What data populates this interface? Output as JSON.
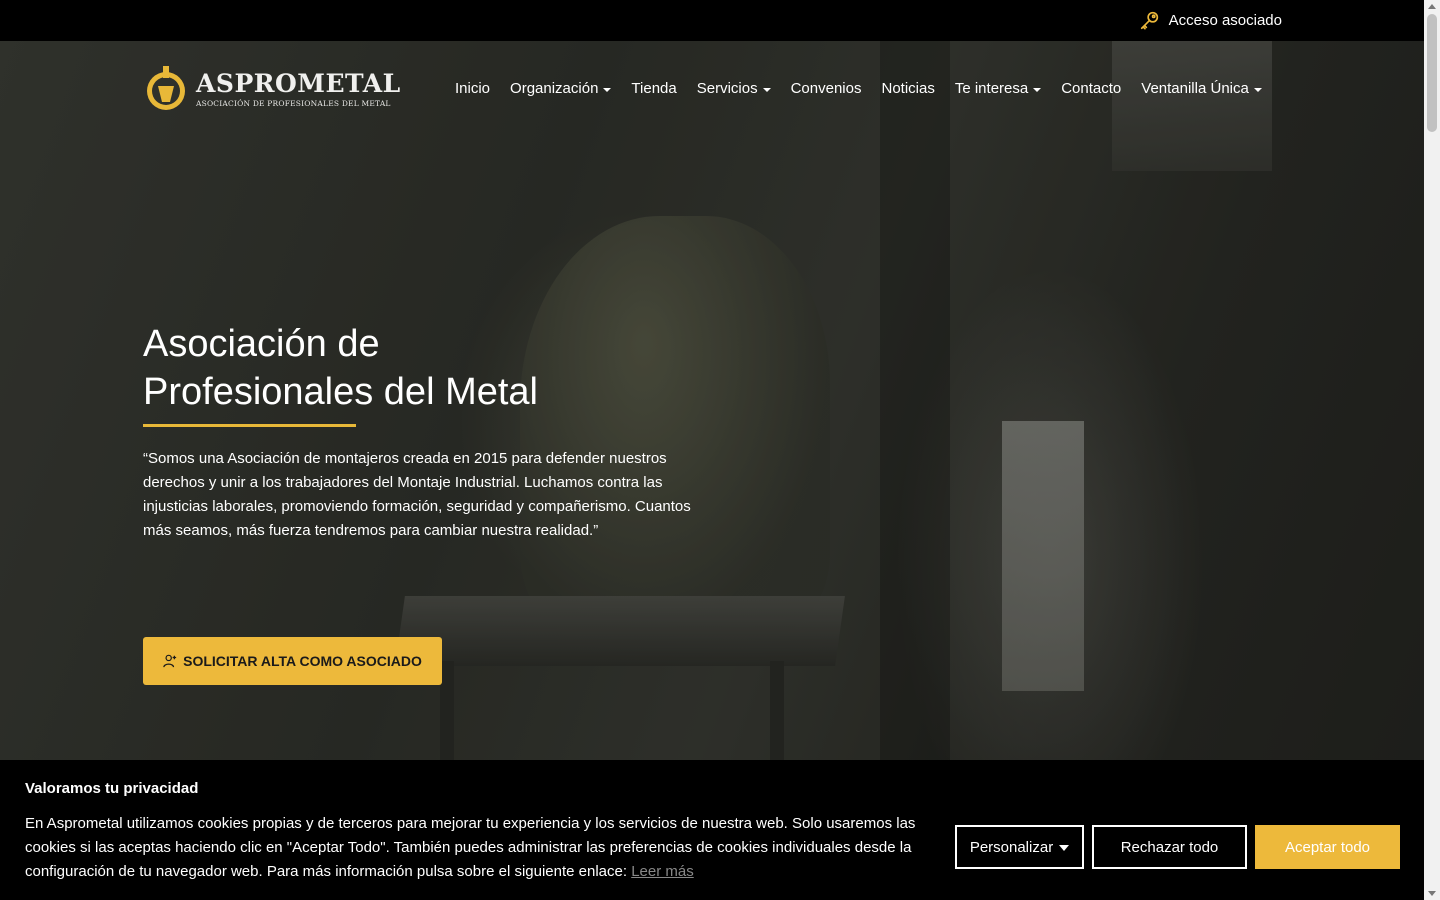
{
  "topbar": {
    "access_label": "Acceso asociado",
    "access_icon": "key-icon"
  },
  "brand": {
    "name": "ASPROMETAL",
    "tagline": "ASOCIACIÓN DE PROFESIONALES DEL METAL",
    "accent_color": "#edb93b"
  },
  "nav": {
    "items": [
      {
        "label": "Inicio",
        "dropdown": false
      },
      {
        "label": "Organización",
        "dropdown": true
      },
      {
        "label": "Tienda",
        "dropdown": false
      },
      {
        "label": "Servicios",
        "dropdown": true
      },
      {
        "label": "Convenios",
        "dropdown": false
      },
      {
        "label": "Noticias",
        "dropdown": false
      },
      {
        "label": "Te interesa",
        "dropdown": true
      },
      {
        "label": "Contacto",
        "dropdown": false
      },
      {
        "label": "Ventanilla Única",
        "dropdown": true
      }
    ]
  },
  "hero": {
    "title_line1": "Asociación de",
    "title_line2": "Profesionales del Metal",
    "quote": "“Somos una Asociación de montajeros creada en 2015 para defender nuestros derechos y unir a los trabajadores del Montaje Industrial. Luchamos contra las injusticias laborales, promoviendo formación, seguridad y compañerismo. Cuantos más seamos, más fuerza tendremos para cambiar nuestra realidad.”",
    "cta_label": "SOLICITAR ALTA COMO ASOCIADO",
    "cta_icon": "user-add-icon"
  },
  "cookie": {
    "title": "Valoramos tu privacidad",
    "text": "En Asprometal utilizamos cookies propias y de terceros para mejorar tu experiencia y los servicios de nuestra web. Solo usaremos las cookies si las aceptas haciendo clic en \"Aceptar Todo\". También puedes administrar las preferencias de cookies individuales desde la configuración de tu navegador web. Para más información pulsa sobre el siguiente enlace: ",
    "link_label": "Leer más",
    "customize_label": "Personalizar",
    "reject_label": "Rechazar todo",
    "accept_label": "Aceptar todo"
  }
}
